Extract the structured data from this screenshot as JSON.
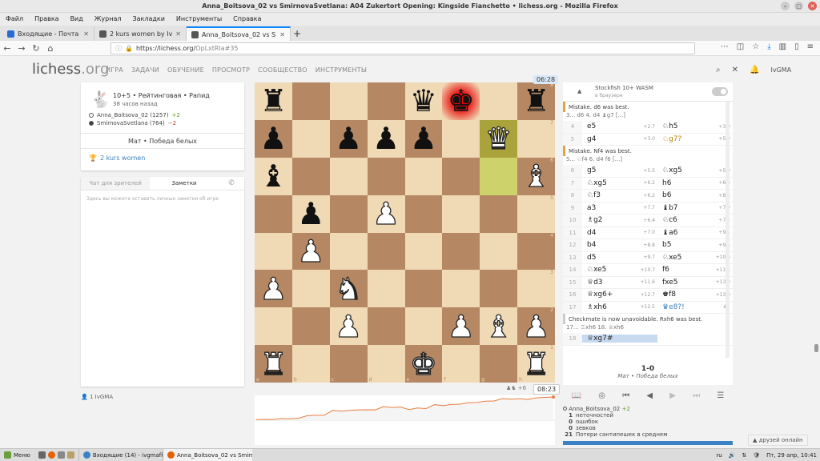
{
  "window": {
    "title": "Anna_Boitsova_02 vs SmirnovaSvetlana: A04 Zukertort Opening: Kingside Fianchetto • lichess.org - Mozilla Firefox"
  },
  "menubar": [
    "Файл",
    "Правка",
    "Вид",
    "Журнал",
    "Закладки",
    "Инструменты",
    "Справка"
  ],
  "tabs": [
    {
      "title": "Входящие - Почта Mail.ru",
      "color": "#2a6ad6"
    },
    {
      "title": "2 kurs women by IvGMA • lich",
      "color": "#555555"
    },
    {
      "title": "Anna_Boitsova_02 vs Smirnov",
      "color": "#555555"
    }
  ],
  "url": {
    "main": "https://lichess.org/",
    "rest": "OpLxtRla#35"
  },
  "site": {
    "logo": "lichess",
    "logo_ext": ".org",
    "nav": [
      "ИГРА",
      "ЗАДАЧИ",
      "ОБУЧЕНИЕ",
      "ПРОСМОТР",
      "СООБЩЕСТВО",
      "ИНСТРУМЕНТЫ"
    ],
    "user": "IvGMA"
  },
  "game": {
    "setup": "10+5 • Рейтинговая • Рапид",
    "ago": "38 часов назад",
    "white": {
      "name": "Anna_Boitsova_02 (1257)",
      "diff": "+2"
    },
    "black": {
      "name": "SmirnovaSvetlana (764)",
      "diff": "−2"
    },
    "status": "Мат • Победа белых",
    "tournament": "2 kurs women"
  },
  "chat": {
    "tab_chat": "Чат для зрителей",
    "tab_notes": "Заметки",
    "placeholder": "Здесь вы можете оставить личные заметки об игре"
  },
  "spectators": {
    "count": "1",
    "user": "IvGMA"
  },
  "clocks": {
    "top": "06:28",
    "bottom": "08:23",
    "material": "+6"
  },
  "board": {
    "ranks": [
      [
        "r",
        "",
        "",
        "",
        "q",
        "k",
        "",
        "r"
      ],
      [
        "p",
        "",
        "p",
        "p",
        "p",
        "",
        "Q",
        ""
      ],
      [
        "b",
        "",
        "",
        "",
        "",
        "",
        "",
        "B"
      ],
      [
        "",
        "p",
        "",
        "P",
        "",
        "",
        "",
        ""
      ],
      [
        "",
        "P",
        "",
        "",
        "",
        "",
        "",
        ""
      ],
      [
        "P",
        "",
        "N",
        "",
        "",
        "",
        "",
        ""
      ],
      [
        "",
        "",
        "P",
        "",
        "",
        "P",
        "B",
        "P"
      ],
      [
        "R",
        "",
        "",
        "",
        "K",
        "",
        "",
        "R"
      ]
    ],
    "last_move": [
      "g7",
      "g6"
    ],
    "check": "f8",
    "files": [
      "a",
      "b",
      "c",
      "d",
      "e",
      "f",
      "g",
      "h"
    ]
  },
  "engine": {
    "name": "Stockfish 10+ WASM",
    "sub": "в браузере"
  },
  "moves": {
    "comment1": "Mistake. d6 was best.",
    "var1": "3... d6 4. d4 ♝g7 [...]",
    "comment2": "Mistake. Nf4 was best.",
    "var2": "5... ♘f4 6. d4 f6 [...]",
    "comment3": "Checkmate is now unavoidable. Rxh6 was best.",
    "var3": "17... ♖xh6 18. ♕xh6",
    "rows_a": [
      {
        "n": "4",
        "w": "e5",
        "we": "+2.7",
        "b": "♘h5",
        "be": "+3.0"
      },
      {
        "n": "5",
        "w": "g4",
        "we": "+3.0",
        "b": "♘g7?",
        "be": "+5.9",
        "bgold": true
      }
    ],
    "rows_b": [
      {
        "n": "6",
        "w": "g5",
        "we": "+5.5",
        "b": "♘xg5",
        "be": "+5.9"
      },
      {
        "n": "7",
        "w": "♘xg5",
        "we": "+6.2",
        "b": "h6",
        "be": "+6.3"
      },
      {
        "n": "8",
        "w": "♘f3",
        "we": "+6.2",
        "b": "b6",
        "be": "+8.2"
      },
      {
        "n": "9",
        "w": "a3",
        "we": "+7.7",
        "b": "♝b7",
        "be": "+7.9"
      },
      {
        "n": "10",
        "w": "♗g2",
        "we": "+6.4",
        "b": "♘c6",
        "be": "+7.4"
      },
      {
        "n": "11",
        "w": "d4",
        "we": "+7.0",
        "b": "♝a6",
        "be": "+9.4"
      },
      {
        "n": "12",
        "w": "b4",
        "we": "+8.8",
        "b": "b5",
        "be": "+9.5"
      },
      {
        "n": "13",
        "w": "d5",
        "we": "+9.7",
        "b": "♘xe5",
        "be": "+10.6"
      },
      {
        "n": "14",
        "w": "♘xe5",
        "we": "+10.7",
        "b": "f6",
        "be": "+11.5"
      },
      {
        "n": "15",
        "w": "♕d3",
        "we": "+11.6",
        "b": "fxe5",
        "be": "+13.0"
      },
      {
        "n": "16",
        "w": "♕xg6+",
        "we": "+12.7",
        "b": "♚f8",
        "be": "+13.0"
      },
      {
        "n": "17",
        "w": "♗xh6",
        "we": "+12.5",
        "b": "♛e8?!",
        "be": "#1",
        "bblue": true
      }
    ],
    "final": {
      "n": "18",
      "w": "♕xg7#"
    }
  },
  "result": {
    "score": "1-0",
    "text": "Мат • Победа белых"
  },
  "summary": {
    "player": "Anna_Boitsova_02",
    "diff": "+2",
    "rows": [
      {
        "n": "1",
        "t": "неточностей"
      },
      {
        "n": "0",
        "t": "ошибок"
      },
      {
        "n": "0",
        "t": "зевков"
      },
      {
        "n": "21",
        "t": "Потери сантипешек в среднем"
      }
    ]
  },
  "friends": "друзей онлайн",
  "taskbar": {
    "menu": "Меню",
    "windows": [
      {
        "title": "Входящие (14) - ivgmafk@...",
        "color": "#3a81c6"
      },
      {
        "title": "Anna_Boitsova_02 vs Smirn...",
        "color": "#e66000"
      }
    ],
    "lang": "ru",
    "clock": "Пт, 29 апр, 10:41"
  },
  "chart_data": {
    "type": "area",
    "title": "",
    "x": [
      0,
      1,
      2,
      3,
      4,
      5,
      6,
      7,
      8,
      9,
      10,
      11,
      12,
      13,
      14,
      15,
      16,
      17,
      18,
      19,
      20,
      21,
      22,
      23,
      24,
      25,
      26,
      27,
      28,
      29,
      30,
      31,
      32,
      33,
      34,
      35
    ],
    "values": [
      0.3,
      0.5,
      0.4,
      1.0,
      0.8,
      1.2,
      2.7,
      3.0,
      3.0,
      5.9,
      5.5,
      5.9,
      6.2,
      6.3,
      6.2,
      8.2,
      7.7,
      7.9,
      6.4,
      7.4,
      7.0,
      9.4,
      8.8,
      9.5,
      9.7,
      10.6,
      10.7,
      11.5,
      11.6,
      13.0,
      12.7,
      13.0,
      12.5,
      13.5,
      13.8,
      14.0
    ],
    "ylim": [
      -15,
      15
    ]
  }
}
